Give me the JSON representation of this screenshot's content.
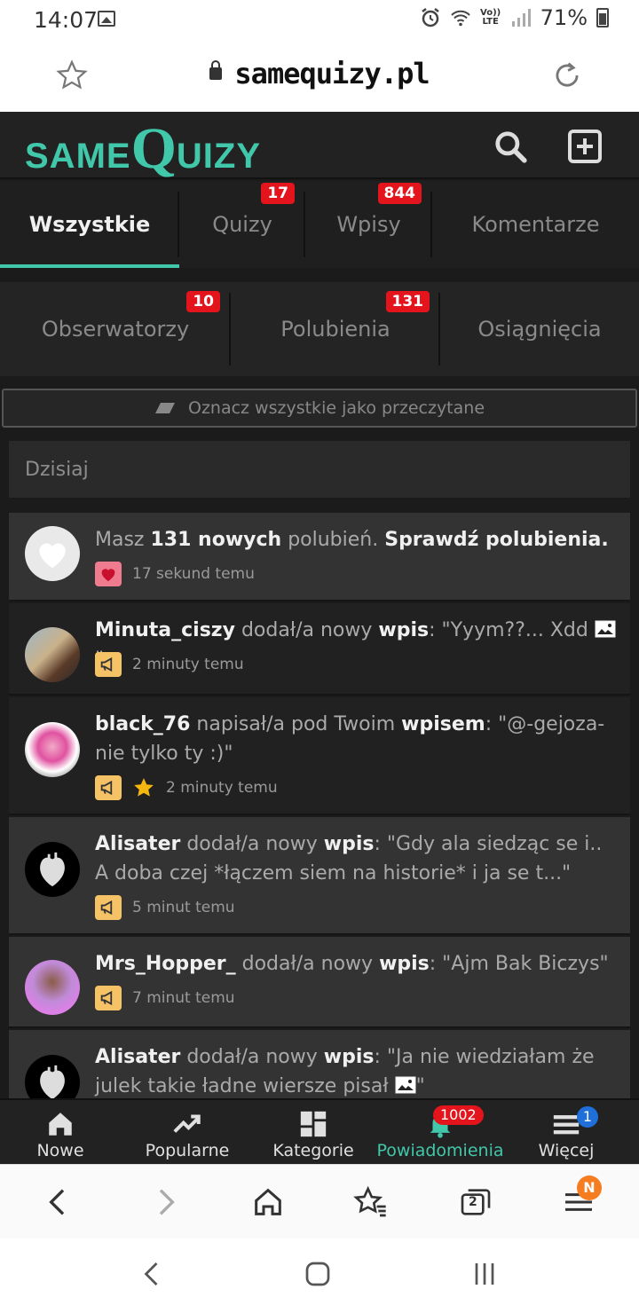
{
  "status_bar": {
    "time": "14:07",
    "signal_text": "Vo)) LTE",
    "battery": "71%"
  },
  "browser": {
    "url": "samequizy.pl"
  },
  "site": {
    "logo_same": "SAME",
    "logo_q": "Q",
    "logo_uizy": "UIZY",
    "brand_color": "#41c7a9"
  },
  "tabs_row1": [
    {
      "label": "Wszystkie",
      "badge": ""
    },
    {
      "label": "Quizy",
      "badge": "17"
    },
    {
      "label": "Wpisy",
      "badge": "844"
    },
    {
      "label": "Komentarze",
      "badge": ""
    }
  ],
  "tabs_row2": [
    {
      "label": "Obserwatorzy",
      "badge": "10"
    },
    {
      "label": "Polubienia",
      "badge": "131"
    },
    {
      "label": "Osiągnięcia",
      "badge": ""
    }
  ],
  "mark_all_read": "Oznacz wszystkie jako przeczytane",
  "day_header": "Dzisiaj",
  "notifications": [
    {
      "parts": [
        {
          "t": "Masz ",
          "b": false
        },
        {
          "t": "131 nowych",
          "b": true
        },
        {
          "t": " polubień. ",
          "b": false
        },
        {
          "t": "Sprawdź polubienia.",
          "b": true
        }
      ],
      "time": "17 sekund temu",
      "type": "like",
      "star": false,
      "bg": "light"
    },
    {
      "parts": [
        {
          "t": "Minuta_ciszy",
          "b": true
        },
        {
          "t": " dodał/a nowy ",
          "b": false
        },
        {
          "t": "wpis",
          "b": true
        },
        {
          "t": ": \"Yyym??... Xdd ",
          "b": false
        }
      ],
      "suffix": "\"",
      "image_icon": true,
      "time": "2 minuty temu",
      "type": "post",
      "star": false,
      "bg": "dark"
    },
    {
      "parts": [
        {
          "t": "black_76",
          "b": true
        },
        {
          "t": " napisał/a pod Twoim ",
          "b": false
        },
        {
          "t": "wpisem",
          "b": true
        },
        {
          "t": ": \"@-gejoza- nie tylko ty :)\"",
          "b": false
        }
      ],
      "time": "2 minuty temu",
      "type": "post",
      "star": true,
      "bg": "dark"
    },
    {
      "parts": [
        {
          "t": "Alisater",
          "b": true
        },
        {
          "t": " dodał/a nowy ",
          "b": false
        },
        {
          "t": "wpis",
          "b": true
        },
        {
          "t": ": \"Gdy ala siedząc se i.. A doba czej *łączem siem na historie* i ja se t...\"",
          "b": false
        }
      ],
      "time": "5 minut temu",
      "type": "post",
      "star": false,
      "bg": "light"
    },
    {
      "parts": [
        {
          "t": "Mrs_Hopper_",
          "b": true
        },
        {
          "t": " dodał/a nowy ",
          "b": false
        },
        {
          "t": "wpis",
          "b": true
        },
        {
          "t": ": \"Ajm Bak Biczys\"",
          "b": false
        }
      ],
      "time": "7 minut temu",
      "type": "post",
      "star": false,
      "bg": "light"
    },
    {
      "parts": [
        {
          "t": "Alisater",
          "b": true
        },
        {
          "t": " dodał/a nowy ",
          "b": false
        },
        {
          "t": "wpis",
          "b": true
        },
        {
          "t": ": \"Ja nie wiedziałam że julek takie ładne wiersze pisał ",
          "b": false
        }
      ],
      "suffix": "\"",
      "image_icon": true,
      "time": "",
      "type": "post",
      "star": false,
      "bg": "light"
    }
  ],
  "bottom_nav": [
    {
      "label": "Nowe",
      "icon": "home-icon",
      "badge": ""
    },
    {
      "label": "Popularne",
      "icon": "trending-icon",
      "badge": ""
    },
    {
      "label": "Kategorie",
      "icon": "grid-icon",
      "badge": ""
    },
    {
      "label": "Powiadomienia",
      "icon": "bell-icon",
      "badge": "1002"
    },
    {
      "label": "Więcej",
      "icon": "menu-icon",
      "badge": "1"
    }
  ],
  "browser_toolbar": {
    "tabs_count": "2",
    "menu_badge": "N"
  }
}
